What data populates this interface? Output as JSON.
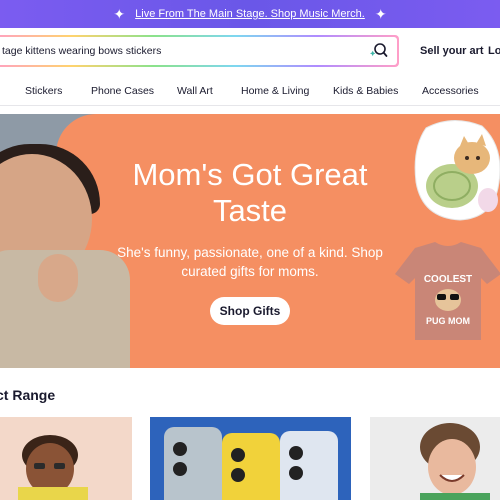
{
  "announcement": {
    "text": "Live From The Main Stage. Shop Music Merch."
  },
  "search": {
    "value": "tage kittens wearing bows stickers"
  },
  "header": {
    "sell_label": "Sell your art",
    "login_label": "Lo"
  },
  "nav": {
    "items": [
      {
        "label": "Stickers"
      },
      {
        "label": "Phone Cases"
      },
      {
        "label": "Wall Art"
      },
      {
        "label": "Home & Living"
      },
      {
        "label": "Kids & Babies"
      },
      {
        "label": "Accessories"
      }
    ]
  },
  "hero": {
    "title": "Mom's Got Great Taste",
    "subtitle": "She's funny, passionate, one of a kind. Shop curated gifts for moms.",
    "button_label": "Shop Gifts",
    "tshirt_text_top": "COOLEST",
    "tshirt_text_bottom": "PUG MOM"
  },
  "section": {
    "title": "ct Range"
  },
  "colors": {
    "announcement_bg": "#6a57e8",
    "hero_bg": "#f58f62",
    "text": "#1a1a2e"
  }
}
